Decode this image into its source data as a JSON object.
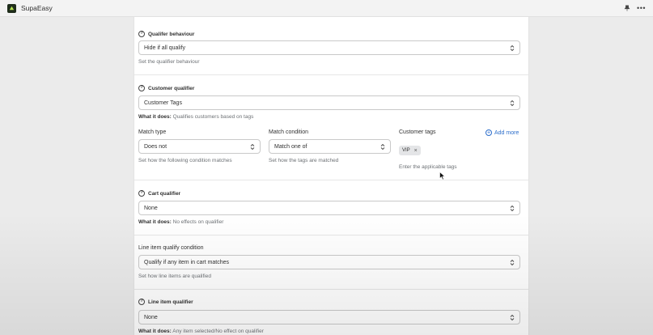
{
  "app": {
    "title": "SupaEasy"
  },
  "qualifier_behaviour": {
    "title": "Qualifer behaviour",
    "selected": "Hide if all qualify",
    "help": "Set the qualifier behaviour"
  },
  "customer_qualifier": {
    "title": "Customer qualifier",
    "selected": "Customer Tags",
    "what_label": "What it does:",
    "what_text": "Qualifies customers based on tags",
    "match_type": {
      "label": "Match type",
      "selected": "Does not",
      "help": "Set how the following condition matches"
    },
    "match_condition": {
      "label": "Match condition",
      "selected": "Match one of",
      "help": "Set how the tags are matched"
    },
    "customer_tags": {
      "label": "Customer tags",
      "add_more": "Add more",
      "tags": [
        "VIP"
      ],
      "help": "Enter the applicable tags"
    }
  },
  "cart_qualifier": {
    "title": "Cart qualifier",
    "selected": "None",
    "what_label": "What it does:",
    "what_text": "No effects on qualifier"
  },
  "line_item_condition": {
    "label": "Line item qualify condition",
    "selected": "Qualify if any item in cart matches",
    "help": "Set how line items are qualified"
  },
  "line_item_qualifier": {
    "title": "Line item qualifier",
    "selected": "None",
    "what_label": "What it does:",
    "what_text": "Any item selected/No effect on qualifier"
  }
}
